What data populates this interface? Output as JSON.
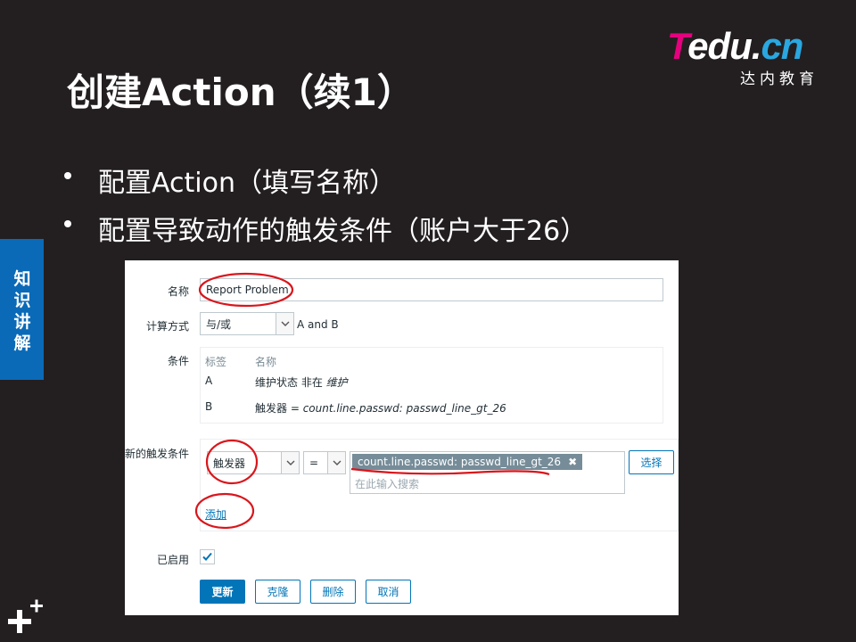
{
  "slide": {
    "title": "创建Action（续1）",
    "bullets": [
      "配置Action（填写名称）",
      "配置导致动作的触发条件（账户大于26）"
    ],
    "side_tab": [
      "知",
      "识",
      "讲",
      "解"
    ]
  },
  "logo": {
    "word_t": "T",
    "word_rest": "edu.",
    "word_cn": "cn",
    "subtitle": "达内教育"
  },
  "form": {
    "name_label": "名称",
    "name_value": "Report Problem",
    "calc_label": "计算方式",
    "calc_value": "与/或",
    "calc_expr": "A and B",
    "conditions_label": "条件",
    "conditions_header": {
      "tag": "标签",
      "name": "名称"
    },
    "conditions": [
      {
        "tag": "A",
        "prefix": "维护状态 非在 ",
        "value": "维护"
      },
      {
        "tag": "B",
        "prefix": "触发器 = ",
        "value": "count.line.passwd: passwd_line_gt_26"
      }
    ],
    "new_cond_label": "新的触发条件",
    "new_cond_type": "触发器",
    "new_cond_op": "=",
    "new_cond_chip": "count.line.passwd: passwd_line_gt_26",
    "new_cond_placeholder": "在此输入搜索",
    "select_button": "选择",
    "add_link": "添加",
    "enabled_label": "已启用",
    "buttons": {
      "update": "更新",
      "clone": "克隆",
      "delete": "删除",
      "cancel": "取消"
    }
  },
  "colors": {
    "background": "#231f20",
    "accent_blue": "#0a6ab8",
    "zabbix_blue": "#0275b8",
    "annotation_red": "#d9161c",
    "logo_magenta": "#e5007e"
  },
  "icons": [
    "chevron-down-icon",
    "remove-x-icon",
    "checkmark-icon",
    "plus-plus-icon"
  ]
}
